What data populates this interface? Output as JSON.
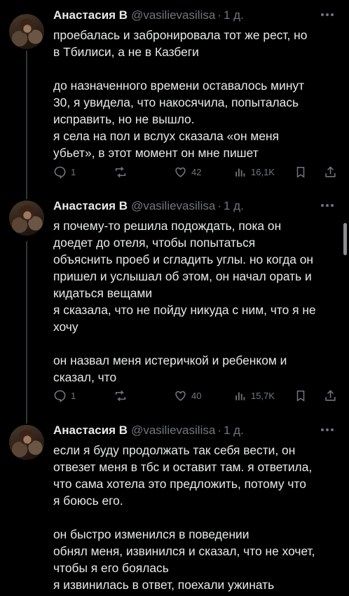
{
  "tweets": [
    {
      "name": "Анастасия В",
      "handle": "@vasilievasilisa",
      "time": "1 д.",
      "lines": [
        "проебалась и забронировала тот же рест, но",
        "в Тбилиси, а не в Казбеги",
        "",
        "до назначенного времени оставалось минут",
        "30, я увидела, что накосячила, попыталась",
        "исправить, но не вышло.",
        "я села на пол и вслух сказала «он меня",
        "убьет», в этот момент он мне пишет"
      ],
      "replies": "1",
      "likes": "42",
      "views": "16,1K"
    },
    {
      "name": "Анастасия В",
      "handle": "@vasilievasilisa",
      "time": "1 д.",
      "lines": [
        "я почему-то решила подождать, пока он",
        "доедет до отеля, чтобы попытаться",
        "объяснить проеб и сгладить углы. но когда он",
        "пришел и услышал об этом, он начал орать и",
        "кидаться вещами",
        "я сказала, что не пойду никуда с ним, что я не",
        "хочу",
        "",
        "он назвал меня истеричкой и ребенком и",
        "сказал, что"
      ],
      "replies": "1",
      "likes": "40",
      "views": "15,7K"
    },
    {
      "name": "Анастасия В",
      "handle": "@vasilievasilisa",
      "time": "1 д.",
      "lines": [
        "если я буду продолжать так себя вести, он",
        "отвезет меня в тбс и оставит там. я ответила,",
        "что сама хотела это предложить, потому что",
        "я боюсь его.",
        "",
        "он быстро изменился в поведении",
        "обнял меня, извинился и сказал, что не хочет,",
        "чтобы я его боялась",
        "я извинилась в ответ, поехали ужинать"
      ]
    }
  ]
}
